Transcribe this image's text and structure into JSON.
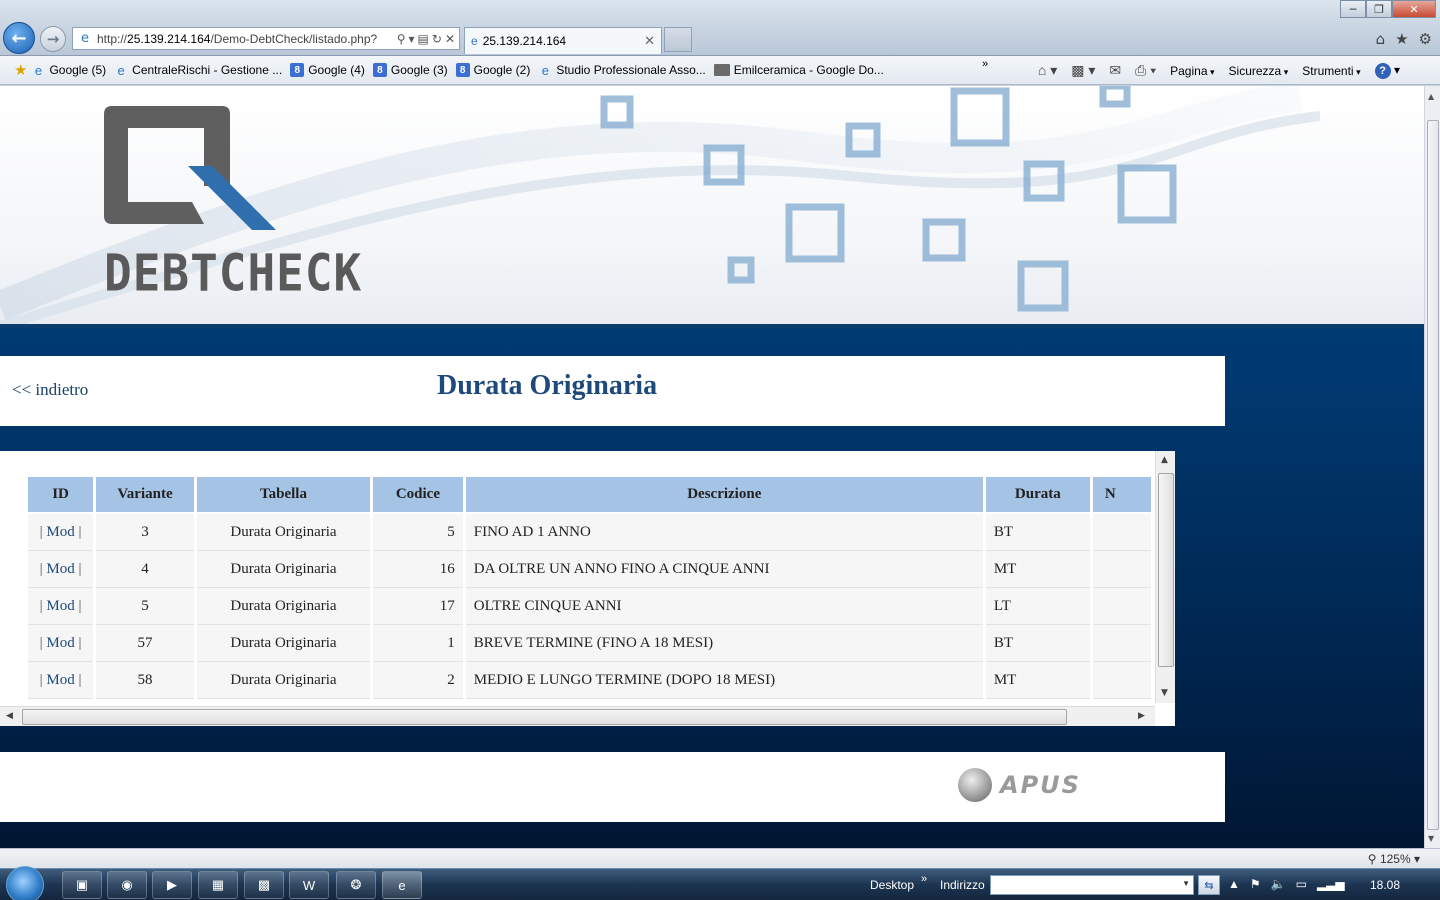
{
  "browser": {
    "url_prefix": "http://",
    "url_host": "25.139.214.164",
    "url_path": "/Demo-DebtCheck/listado.php?",
    "tab_title": "25.139.214.164",
    "favorites": [
      {
        "label": "Google (5)",
        "icon": "ie-page-icon"
      },
      {
        "label": "CentraleRischi - Gestione ...",
        "icon": "ie-page-icon"
      },
      {
        "label": "Google (4)",
        "icon": "google-icon"
      },
      {
        "label": "Google (3)",
        "icon": "google-icon"
      },
      {
        "label": "Google (2)",
        "icon": "google-icon"
      },
      {
        "label": "Studio Professionale Asso...",
        "icon": "ie-page-icon"
      },
      {
        "label": "Emilceramica - Google Do...",
        "icon": "folder-icon"
      }
    ],
    "commands": {
      "page": "Pagina",
      "safety": "Sicurezza",
      "tools": "Strumenti"
    },
    "zoom": "125%"
  },
  "page": {
    "logo_text": "DEBTCHECK",
    "back_link": "<< indietro",
    "title": "Durata Originaria",
    "footer_logo_text": "APUS",
    "table": {
      "columns": [
        "ID",
        "Variante",
        "Tabella",
        "Codice",
        "Descrizione",
        "Durata",
        "N"
      ],
      "mod_label": "Mod",
      "rows": [
        {
          "variante": "3",
          "tabella": "Durata Originaria",
          "codice": "5",
          "descrizione": "FINO AD 1 ANNO",
          "durata": "BT"
        },
        {
          "variante": "4",
          "tabella": "Durata Originaria",
          "codice": "16",
          "descrizione": "DA OLTRE UN ANNO FINO A CINQUE ANNI",
          "durata": "MT"
        },
        {
          "variante": "5",
          "tabella": "Durata Originaria",
          "codice": "17",
          "descrizione": "OLTRE CINQUE ANNI",
          "durata": "LT"
        },
        {
          "variante": "57",
          "tabella": "Durata Originaria",
          "codice": "1",
          "descrizione": "BREVE TERMINE (FINO A 18 MESI)",
          "durata": "BT"
        },
        {
          "variante": "58",
          "tabella": "Durata Originaria",
          "codice": "2",
          "descrizione": "MEDIO E LUNGO TERMINE (DOPO 18 MESI)",
          "durata": "MT"
        }
      ]
    }
  },
  "taskbar": {
    "desktop": "Desktop",
    "address_label": "Indirizzo",
    "clock": "18.08",
    "apps": [
      "explorer-icon",
      "chrome-icon",
      "media-player-icon",
      "folder-icon",
      "network-icon",
      "word-icon",
      "remote-icon",
      "ie-icon"
    ]
  },
  "colors": {
    "header_blue": "#a4c3e5",
    "title_blue": "#1d4a7a",
    "page_bg": "#00386f"
  }
}
